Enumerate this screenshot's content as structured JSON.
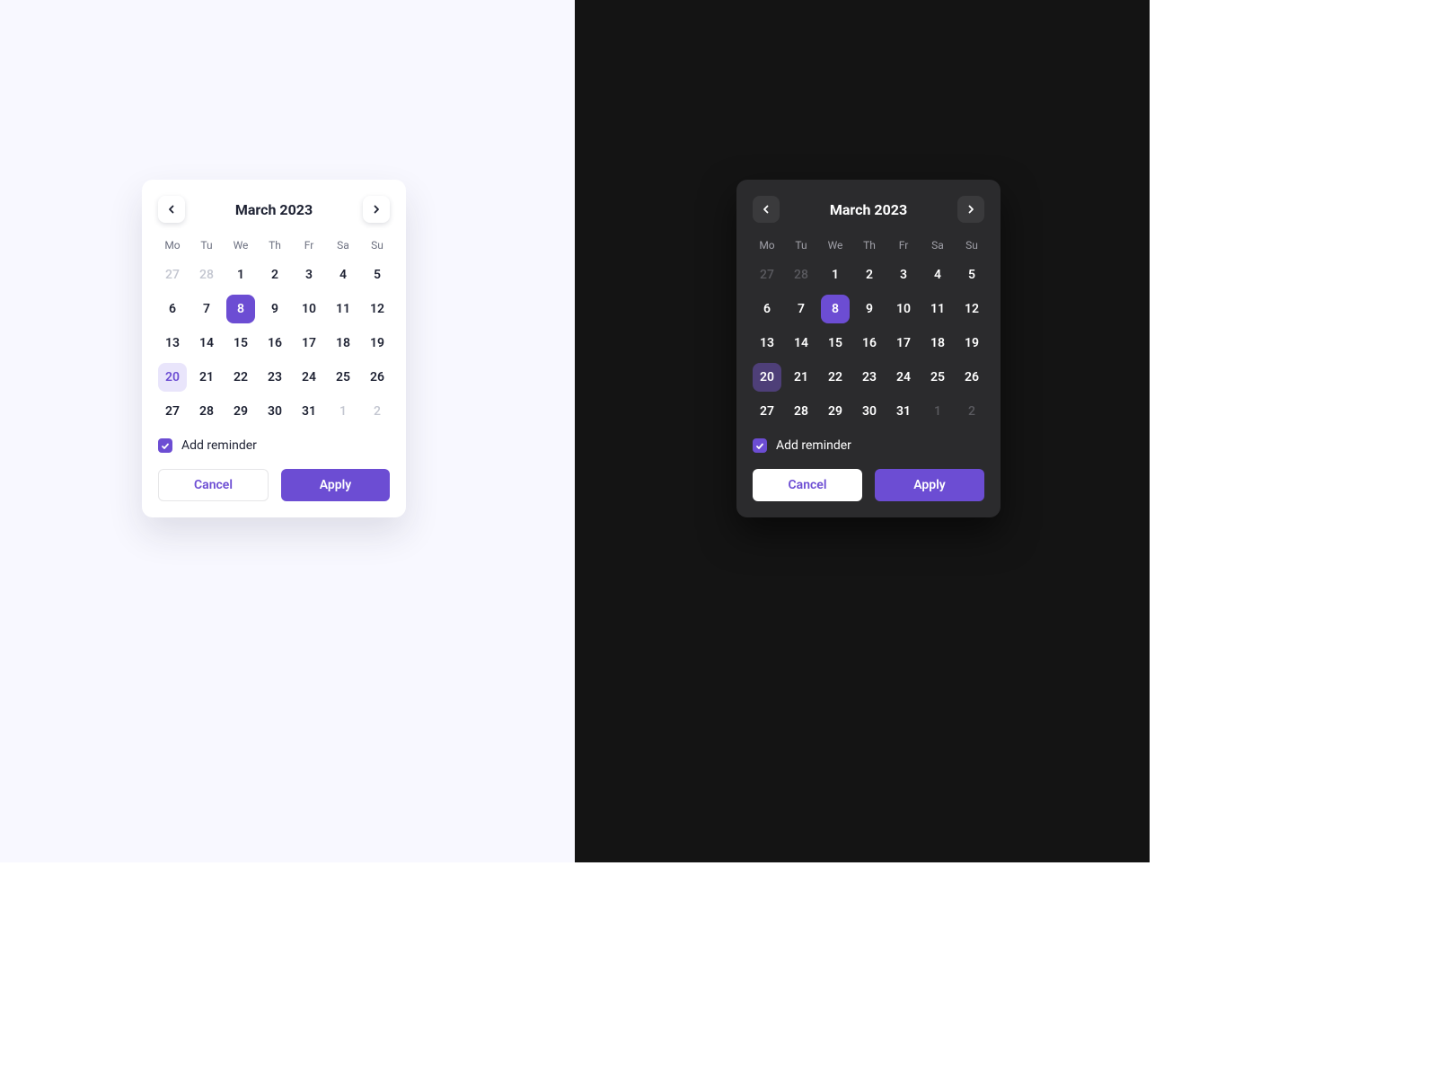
{
  "colors": {
    "accent": "#6C4DD3",
    "accent_hover_light": "#E9E5FB",
    "light_bg": "#F8F8FF",
    "dark_bg": "#141414",
    "card_dark": "#2B2B2D"
  },
  "calendar": {
    "title": "March 2023",
    "dow": [
      "Mo",
      "Tu",
      "We",
      "Th",
      "Fr",
      "Sa",
      "Su"
    ],
    "selected_day": 8,
    "hovered_day": 20,
    "weeks": [
      [
        {
          "n": 27,
          "other": true
        },
        {
          "n": 28,
          "other": true
        },
        {
          "n": 1
        },
        {
          "n": 2
        },
        {
          "n": 3
        },
        {
          "n": 4
        },
        {
          "n": 5
        }
      ],
      [
        {
          "n": 6
        },
        {
          "n": 7
        },
        {
          "n": 8,
          "selected": true
        },
        {
          "n": 9
        },
        {
          "n": 10
        },
        {
          "n": 11
        },
        {
          "n": 12
        }
      ],
      [
        {
          "n": 13
        },
        {
          "n": 14
        },
        {
          "n": 15
        },
        {
          "n": 16
        },
        {
          "n": 17
        },
        {
          "n": 18
        },
        {
          "n": 19
        }
      ],
      [
        {
          "n": 20,
          "hovered": true
        },
        {
          "n": 21
        },
        {
          "n": 22
        },
        {
          "n": 23
        },
        {
          "n": 24
        },
        {
          "n": 25
        },
        {
          "n": 26
        }
      ],
      [
        {
          "n": 27
        },
        {
          "n": 28
        },
        {
          "n": 29
        },
        {
          "n": 30
        },
        {
          "n": 31
        },
        {
          "n": 1,
          "other": true
        },
        {
          "n": 2,
          "other": true
        }
      ]
    ],
    "reminder": {
      "label": "Add reminder",
      "checked": true
    },
    "buttons": {
      "cancel": "Cancel",
      "apply": "Apply"
    }
  }
}
